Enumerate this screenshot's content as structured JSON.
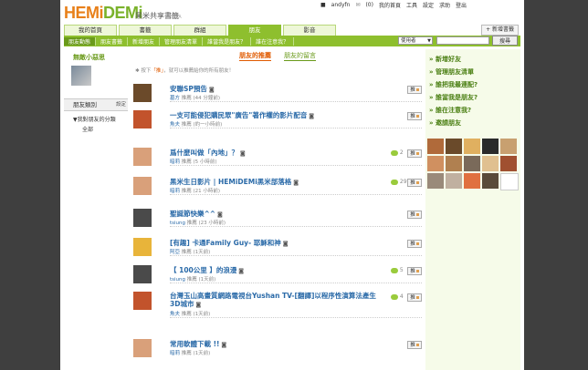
{
  "header": {
    "logo_a": "HEMi",
    "logo_b": "DEMi",
    "logo_sub": "黑米共享書籤",
    "logo_beta": "BETA",
    "user": "andyfn",
    "mail_count": "(0)",
    "links": [
      "我的首頁",
      "工具",
      "設定",
      "求助",
      "登出"
    ]
  },
  "tabs": [
    {
      "label": "我的首頁",
      "active": false
    },
    {
      "label": "書籤",
      "active": false
    },
    {
      "label": "群組",
      "active": false
    },
    {
      "label": "朋友",
      "active": true
    },
    {
      "label": "影音",
      "active": false
    }
  ],
  "new_bookmark": "+ 新增書籤",
  "subnav": [
    "朋友動態",
    "朋友書籤",
    "新增朋友",
    "管理朋友清單",
    "誰當我是朋友？",
    "誰在注意我？"
  ],
  "search": {
    "select_value": "使用者",
    "button": "搜尋"
  },
  "left": {
    "mood": "無敵小惡思",
    "category_header": "朋友類別",
    "category_setting": "設定",
    "category_item": "▼我對朋友的分類",
    "category_all": "全部"
  },
  "main": {
    "tab_active": "朋友的推薦",
    "tab_other": "朋友的留言",
    "hint_prefix": "按下",
    "hint_key": "「推」",
    "hint_suffix": "，就可以推薦給你的所有朋友！",
    "items": [
      {
        "title": "安聯SP預告",
        "user": "墓方",
        "action": "推薦",
        "time": "(44 分鐘前)",
        "count": "",
        "avatar": "#6b4a2a"
      },
      {
        "title": "一支可能侵犯購民眾\"廣告\"著作權的影片配音",
        "user": "魚夫",
        "action": "推薦",
        "time": "(約一小時前)",
        "count": "",
        "avatar": "#c2532c"
      },
      {
        "title": "爲什麼叫做「內地」？",
        "user": "暗莉",
        "action": "推薦",
        "time": "(5 小時前)",
        "count": "2",
        "avatar": "#d9a07a"
      },
      {
        "title": "黑米生日影片 | HEMiDEMi黑米部落格",
        "user": "暗莉",
        "action": "推薦",
        "time": "(21 小時前)",
        "count": "29",
        "avatar": "#d9a07a"
      },
      {
        "title": "聖誕節快樂^^",
        "user": "tsiung",
        "action": "推薦",
        "time": "(23 小時前)",
        "count": "",
        "avatar": "#4a4a4a"
      },
      {
        "title": "[有趣] 卡通Family Guy- 耶穌和神",
        "user": "阿亞",
        "action": "推薦",
        "time": "(1天前)",
        "count": "",
        "avatar": "#e8b43a"
      },
      {
        "title": "【 100公里 】的浪漫",
        "user": "tsiung",
        "action": "推薦",
        "time": "(1天前)",
        "count": "5",
        "avatar": "#4a4a4a"
      },
      {
        "title": "台灣玉山高畫質網路電視台Yushan TV-[翻譯]以程序性演算法產生3D城市",
        "user": "魚夫",
        "action": "推薦",
        "time": "(1天前)",
        "count": "4",
        "avatar": "#c2532c"
      },
      {
        "title": "常用軟體下載 !!",
        "user": "暗莉",
        "action": "推薦",
        "time": "(1天前)",
        "count": "",
        "avatar": "#d9a07a"
      }
    ],
    "push_label": "推"
  },
  "right": {
    "links": [
      "» 新增好友",
      "» 管理朋友清單",
      "» 誰把我最連配?",
      "» 誰當我是朋友?",
      "» 誰在注意我?",
      "» 邀請朋友"
    ]
  },
  "thumbs": [
    "#b06a3a",
    "#6a4a2a",
    "#e0b060",
    "#2a2a2a",
    "#c8a070",
    "#d09060",
    "#b08050",
    "#7a6a5a",
    "#e0c090",
    "#a05030",
    "#9a8a7a",
    "#c0b0a0",
    "#e07040",
    "#5a4a3a",
    "#ffffff"
  ]
}
